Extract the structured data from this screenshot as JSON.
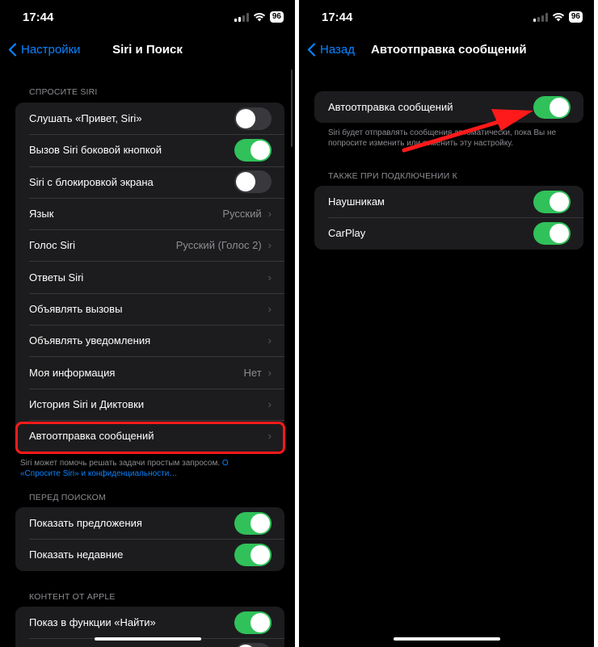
{
  "left": {
    "status": {
      "time": "17:44",
      "battery": "96"
    },
    "nav": {
      "back_label": "Настройки",
      "title": "Siri и Поиск"
    },
    "sections": {
      "ask_siri": "СПРОСИТЕ SIRI",
      "before_search": "ПЕРЕД ПОИСКОМ",
      "apple_content": "КОНТЕНТ ОТ APPLE"
    },
    "ask_rows": [
      {
        "label": "Слушать «Привет, Siri»",
        "toggle": "off"
      },
      {
        "label": "Вызов Siri боковой кнопкой",
        "toggle": "on"
      },
      {
        "label": "Siri с блокировкой экрана",
        "toggle": "off"
      },
      {
        "label": "Язык",
        "value": "Русский"
      },
      {
        "label": "Голос Siri",
        "value": "Русский (Голос 2)"
      },
      {
        "label": "Ответы Siri"
      },
      {
        "label": "Объявлять вызовы"
      },
      {
        "label": "Объявлять уведомления"
      },
      {
        "label": "Моя информация",
        "value": "Нет"
      },
      {
        "label": "История Siri и Диктовки"
      },
      {
        "label": "Автоотправка сообщений"
      }
    ],
    "footer": {
      "text": "Siri может помочь решать задачи простым запросом. ",
      "link_1": "О",
      "link_2": "«Спросите Siri» и конфиденциальности…"
    },
    "search_rows": [
      {
        "label": "Показать предложения",
        "toggle": "on"
      },
      {
        "label": "Показать недавние",
        "toggle": "on"
      }
    ],
    "apple_rows": [
      {
        "label": "Показ в функции «Найти»",
        "toggle": "on"
      },
      {
        "label": "",
        "toggle": "off"
      }
    ]
  },
  "right": {
    "status": {
      "time": "17:44",
      "battery": "96"
    },
    "nav": {
      "back_label": "Назад",
      "title": "Автоотправка сообщений"
    },
    "main_row": {
      "label": "Автоотправка сообщений",
      "toggle": "on"
    },
    "main_footer": "Siri будет отправлять сообщения автоматически, пока Вы не попросите изменить или отменить эту настройку.",
    "connection_header": "ТАКЖЕ ПРИ ПОДКЛЮЧЕНИИ К",
    "connection_rows": [
      {
        "label": "Наушникам",
        "toggle": "on"
      },
      {
        "label": "CarPlay",
        "toggle": "on"
      }
    ]
  },
  "colors": {
    "background": "#000000",
    "cell": "#1c1c1e",
    "toggle_on": "#30c15a",
    "accent_link": "#0a84ff",
    "annotation_red": "#ff1a1a"
  },
  "icons": [
    "wifi-icon",
    "signal-icon",
    "chevron-left-icon",
    "chevron-right-icon",
    "red-arrow-annotation"
  ]
}
